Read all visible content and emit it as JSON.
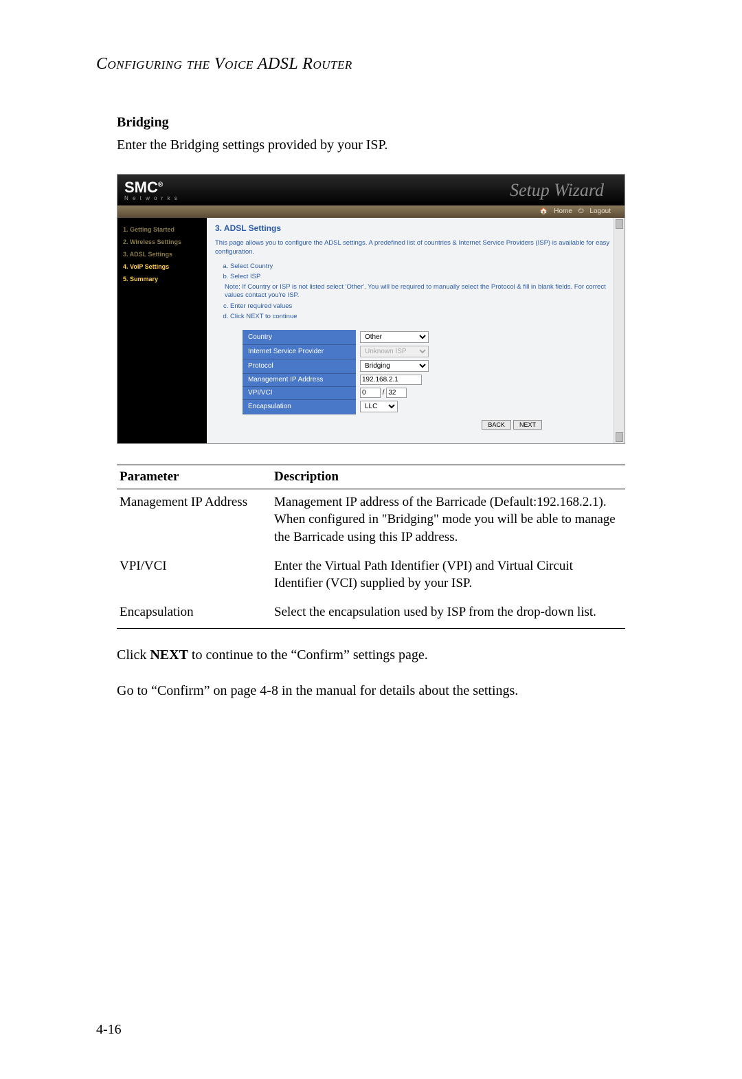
{
  "header_title": "Configuring the Voice ADSL Router",
  "section_heading": "Bridging",
  "intro": "Enter the Bridging settings provided by your ISP.",
  "screenshot": {
    "logo": "SMC",
    "logo_sub": "N e t w o r k s",
    "wizard_title": "Setup Wizard",
    "toolbar": {
      "home": "Home",
      "logout": "Logout"
    },
    "sidebar": [
      "1. Getting Started",
      "2. Wireless Settings",
      "3. ADSL Settings",
      "4. VoIP Settings",
      "5. Summary"
    ],
    "panel_title": "3. ADSL Settings",
    "panel_desc": "This page allows you to configure the ADSL settings. A predefined list of countries & Internet Service Providers (ISP) is available for easy configuration.",
    "steps": {
      "a": "Select Country",
      "b": "Select ISP",
      "note": "Note: If Country or ISP is not listed select 'Other'. You will be required to manually select the Protocol & fill in blank fields. For correct values contact you're ISP.",
      "c": "Enter required values",
      "d": "Click NEXT to continue"
    },
    "rows": {
      "country": {
        "label": "Country",
        "value": "Other"
      },
      "isp": {
        "label": "Internet Service Provider",
        "value": "Unknown ISP"
      },
      "protocol": {
        "label": "Protocol",
        "value": "Bridging"
      },
      "mgmt_ip": {
        "label": "Management IP Address",
        "value": "192.168.2.1"
      },
      "vpivci": {
        "label": "VPI/VCI",
        "vpi": "0",
        "sep": "/",
        "vci": "32"
      },
      "encap": {
        "label": "Encapsulation",
        "value": "LLC"
      }
    },
    "buttons": {
      "back": "BACK",
      "next": "NEXT"
    }
  },
  "param_table": {
    "headers": {
      "param": "Parameter",
      "desc": "Description"
    },
    "rows": [
      {
        "param": "Management IP Address",
        "desc": "Management IP address of the Barricade (Default:192.168.2.1). When configured in \"Bridging\" mode you will be able to manage the Barricade using this IP address."
      },
      {
        "param": "VPI/VCI",
        "desc": "Enter the Virtual Path Identifier (VPI) and Virtual Circuit Identifier (VCI) supplied by your ISP."
      },
      {
        "param": "Encapsulation",
        "desc": "Select the encapsulation used by ISP from the drop-down list."
      }
    ]
  },
  "after_table_1a": "Click ",
  "after_table_1b": "NEXT",
  "after_table_1c": " to continue to the “Confirm” settings page.",
  "after_table_2": "Go to “Confirm” on page 4-8 in the manual for details about the settings.",
  "page_number": "4-16"
}
